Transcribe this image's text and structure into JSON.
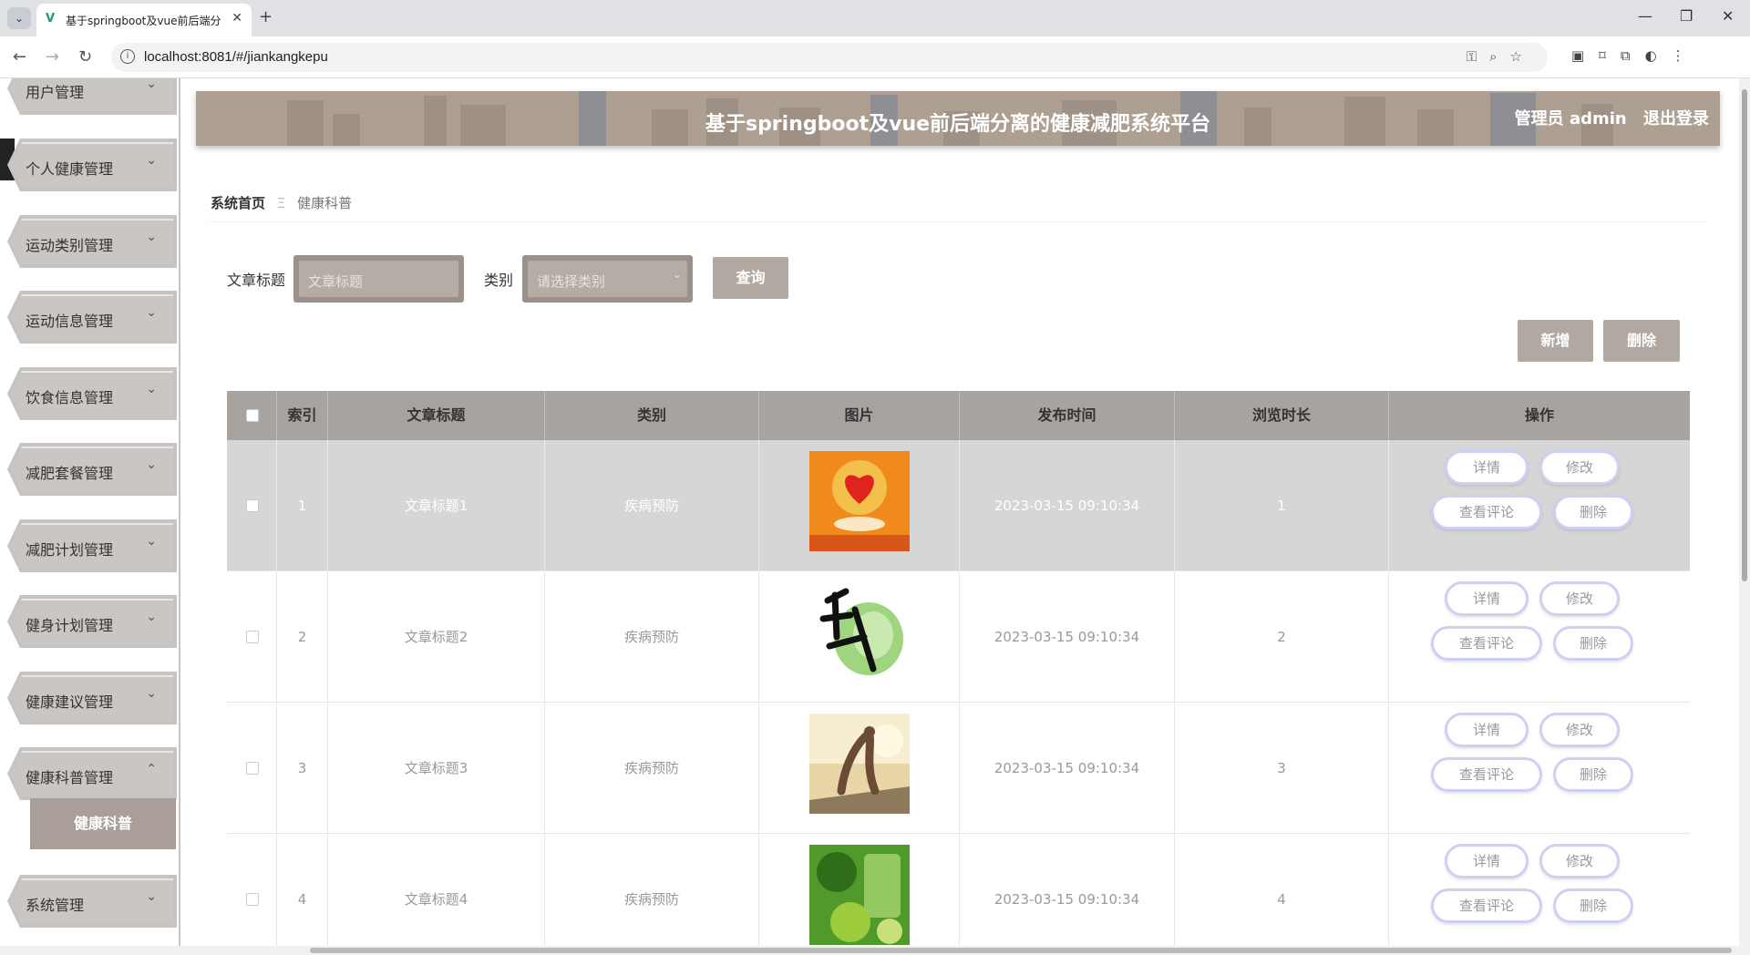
{
  "browser": {
    "tab_title": "基于springboot及vue前后端分",
    "url": "localhost:8081/#/jiankangkepu"
  },
  "sidebar": {
    "items": [
      {
        "label": "用户管理"
      },
      {
        "label": "个人健康管理"
      },
      {
        "label": "运动类别管理"
      },
      {
        "label": "运动信息管理"
      },
      {
        "label": "饮食信息管理"
      },
      {
        "label": "减肥套餐管理"
      },
      {
        "label": "减肥计划管理"
      },
      {
        "label": "健身计划管理"
      },
      {
        "label": "健康建议管理"
      },
      {
        "label": "健康科普管理"
      },
      {
        "label": "系统管理"
      }
    ],
    "sub_item": "健康科普"
  },
  "header": {
    "title": "基于springboot及vue前后端分离的健康减肥系统平台",
    "user": "管理员 admin",
    "logout": "退出登录"
  },
  "breadcrumb": {
    "home": "系统首页",
    "current": "健康科普"
  },
  "search": {
    "title_label": "文章标题",
    "title_placeholder": "文章标题",
    "category_label": "类别",
    "category_placeholder": "请选择类别",
    "query_button": "查询"
  },
  "actions": {
    "add": "新增",
    "delete": "删除"
  },
  "table": {
    "headers": [
      "索引",
      "文章标题",
      "类别",
      "图片",
      "发布时间",
      "浏览时长",
      "操作"
    ],
    "rows": [
      {
        "index": "1",
        "title": "文章标题1",
        "category": "疾病预防",
        "time": "2023-03-15 09:10:34",
        "views": "1"
      },
      {
        "index": "2",
        "title": "文章标题2",
        "category": "疾病预防",
        "time": "2023-03-15 09:10:34",
        "views": "2"
      },
      {
        "index": "3",
        "title": "文章标题3",
        "category": "疾病预防",
        "time": "2023-03-15 09:10:34",
        "views": "3"
      },
      {
        "index": "4",
        "title": "文章标题4",
        "category": "疾病预防",
        "time": "2023-03-15 09:10:34",
        "views": "4"
      }
    ],
    "op_labels": {
      "detail": "详情",
      "edit": "修改",
      "comments": "查看评论",
      "delete": "删除"
    }
  },
  "colors": {
    "header_bg": "#ae9f93",
    "table_header": "#a9a39f",
    "button": "#b1a8a2",
    "op_border": "#cdd0f2"
  }
}
